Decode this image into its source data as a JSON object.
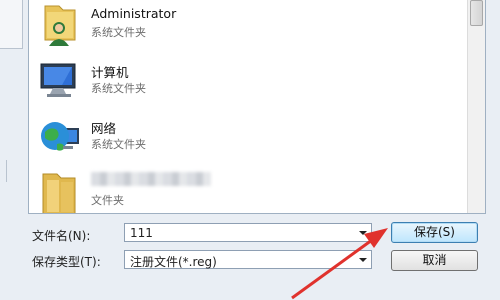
{
  "list": {
    "items": [
      {
        "name": "Administrator",
        "type": "系统文件夹",
        "icon": "user-folder-icon"
      },
      {
        "name": "计算机",
        "type": "系统文件夹",
        "icon": "computer-icon"
      },
      {
        "name": "网络",
        "type": "系统文件夹",
        "icon": "network-globe-icon"
      },
      {
        "name": "",
        "type": "文件夹",
        "icon": "folder-icon",
        "name_blurred": true
      }
    ]
  },
  "form": {
    "filename_label": "文件名(N):",
    "filename_value": "111",
    "filetype_label": "保存类型(T):",
    "filetype_value": "注册文件(*.reg)"
  },
  "buttons": {
    "save": "保存(S)",
    "cancel": "取消"
  },
  "colors": {
    "annotation_arrow": "#e0322d",
    "focus_button_border": "#3c7fb1"
  }
}
